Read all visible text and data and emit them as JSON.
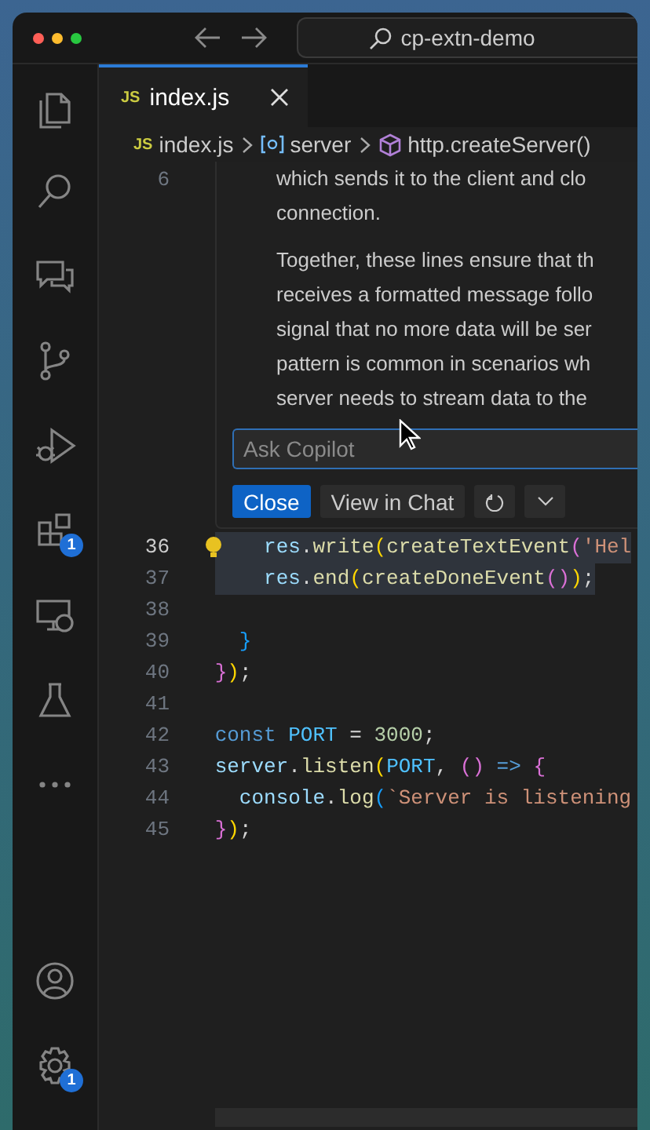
{
  "window": {
    "search": "cp-extn-demo"
  },
  "activity_bar": [
    {
      "kind": "files"
    },
    {
      "kind": "search"
    },
    {
      "kind": "chat"
    },
    {
      "kind": "source-control"
    },
    {
      "kind": "run-debug"
    },
    {
      "kind": "extensions",
      "badge": "1"
    },
    {
      "kind": "remote"
    },
    {
      "kind": "testing"
    },
    {
      "kind": "more"
    }
  ],
  "activity_bar_bottom": [
    {
      "kind": "account"
    },
    {
      "kind": "settings",
      "badge": "1"
    }
  ],
  "tabs": [
    {
      "icon_text": "JS",
      "label": "index.js",
      "selected": true
    }
  ],
  "breadcrumb": [
    {
      "kind": "file",
      "icon_text": "JS",
      "label": "index.js"
    },
    {
      "kind": "variable",
      "label": "server"
    },
    {
      "kind": "method",
      "label": "http.createServer()"
    }
  ],
  "top_line": {
    "number": "6"
  },
  "inline_chat": {
    "paragraphs": [
      [
        "which sends it to the client and clo",
        "connection."
      ],
      [
        "Together, these lines ensure that th",
        "receives a formatted message follo",
        "signal that no more data will be ser",
        "pattern is common in scenarios wh",
        "server needs to stream data to the"
      ]
    ],
    "placeholder": "Ask Copilot",
    "buttons": [
      {
        "kind": "primary",
        "label": "Close"
      },
      {
        "kind": "secondary",
        "label": "View in Chat"
      },
      {
        "kind": "refresh"
      },
      {
        "kind": "dropdown"
      }
    ]
  },
  "code_lines": [
    {
      "number": "36",
      "current": true,
      "selected": true,
      "lightbulb": true,
      "tokens": [
        {
          "kind": "var",
          "t": "    res"
        },
        {
          "kind": "plain",
          "t": "."
        },
        {
          "kind": "fn",
          "t": "write"
        },
        {
          "kind": "b1",
          "t": "("
        },
        {
          "kind": "fn",
          "t": "createTextEvent"
        },
        {
          "kind": "b2",
          "t": "("
        },
        {
          "kind": "str",
          "t": "'Hel"
        }
      ]
    },
    {
      "number": "37",
      "current": false,
      "selected": true,
      "lightbulb": false,
      "tokens": [
        {
          "kind": "var",
          "t": "    res"
        },
        {
          "kind": "plain",
          "t": "."
        },
        {
          "kind": "fn",
          "t": "end"
        },
        {
          "kind": "b1",
          "t": "("
        },
        {
          "kind": "fn",
          "t": "createDoneEvent"
        },
        {
          "kind": "b2",
          "t": "()"
        },
        {
          "kind": "b1",
          "t": ")"
        },
        {
          "kind": "plain",
          "t": ";"
        }
      ]
    },
    {
      "number": "38",
      "current": false,
      "selected": false,
      "lightbulb": false
    },
    {
      "number": "39",
      "current": false,
      "selected": false,
      "lightbulb": false,
      "tokens": [
        {
          "kind": "b3",
          "t": "  }"
        }
      ]
    },
    {
      "number": "40",
      "current": false,
      "selected": false,
      "lightbulb": false,
      "tokens": [
        {
          "kind": "b2",
          "t": "}"
        },
        {
          "kind": "b1",
          "t": ")"
        },
        {
          "kind": "plain",
          "t": ";"
        }
      ]
    },
    {
      "number": "41",
      "current": false,
      "selected": false,
      "lightbulb": false
    },
    {
      "number": "42",
      "current": false,
      "selected": false,
      "lightbulb": false,
      "tokens": [
        {
          "kind": "kw",
          "t": "const"
        },
        {
          "kind": "const",
          "t": " PORT"
        },
        {
          "kind": "plain",
          "t": " = "
        },
        {
          "kind": "num",
          "t": "3000"
        },
        {
          "kind": "plain",
          "t": ";"
        }
      ]
    },
    {
      "number": "43",
      "current": false,
      "selected": false,
      "lightbulb": false,
      "tokens": [
        {
          "kind": "var",
          "t": "server"
        },
        {
          "kind": "plain",
          "t": "."
        },
        {
          "kind": "fn",
          "t": "listen"
        },
        {
          "kind": "b1",
          "t": "("
        },
        {
          "kind": "const",
          "t": "PORT"
        },
        {
          "kind": "plain",
          "t": ", "
        },
        {
          "kind": "b2",
          "t": "()"
        },
        {
          "kind": "kw",
          "t": " => "
        },
        {
          "kind": "b2",
          "t": "{"
        }
      ]
    },
    {
      "number": "44",
      "current": false,
      "selected": false,
      "lightbulb": false,
      "tokens": [
        {
          "kind": "var",
          "t": "  console"
        },
        {
          "kind": "plain",
          "t": "."
        },
        {
          "kind": "fn",
          "t": "log"
        },
        {
          "kind": "b3",
          "t": "("
        },
        {
          "kind": "str",
          "t": "`Server is listening"
        }
      ]
    },
    {
      "number": "45",
      "current": false,
      "selected": false,
      "lightbulb": false,
      "tokens": [
        {
          "kind": "b2",
          "t": "}"
        },
        {
          "kind": "b1",
          "t": ")"
        },
        {
          "kind": "plain",
          "t": ";"
        }
      ]
    }
  ]
}
